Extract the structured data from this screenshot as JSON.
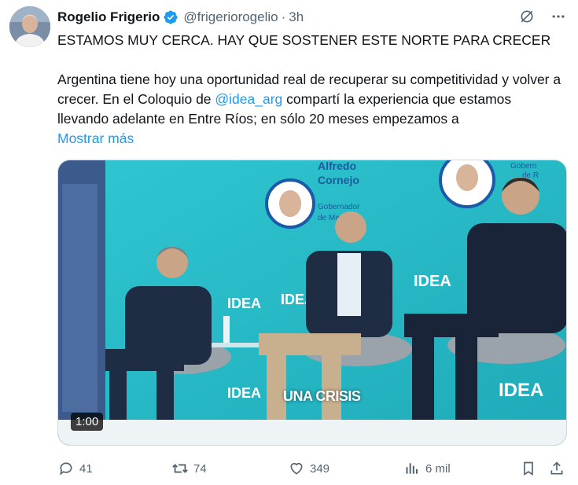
{
  "author": {
    "display_name": "Rogelio Frigerio",
    "handle": "@frigeriorogelio",
    "separator": "·",
    "time": "3h"
  },
  "icons": {
    "verified": "verified-badge-icon",
    "grok": "grok-icon",
    "more": "more-options-icon",
    "reply": "reply-icon",
    "retweet": "retweet-icon",
    "like": "heart-icon",
    "views": "views-icon",
    "bookmark": "bookmark-icon",
    "share": "share-icon"
  },
  "tweet": {
    "line1": "ESTAMOS MUY CERCA. HAY QUE SOSTENER ESTE NORTE PARA CRECER",
    "para_before_mention": "Argentina tiene hoy una oportunidad real de recuperar su competitividad y volver a crecer. En el Coloquio de ",
    "mention": "@idea_arg",
    "para_after_mention": " compartí la experiencia que estamos llevando adelante en Entre Ríos; en sólo 20 meses empezamos a",
    "show_more": "Mostrar más"
  },
  "media": {
    "duration": "1:00",
    "caption": "UNA CRISIS",
    "screen_name_1": "Alfredo",
    "screen_name_2": "Cornejo",
    "screen_role_1": "Gobernador",
    "screen_role_2": "de Men",
    "screen_role_3": "Gobern",
    "screen_role_4": "de R",
    "brand": "IDEA"
  },
  "stats": {
    "replies": "41",
    "retweets": "74",
    "likes": "349",
    "views": "6 mil"
  },
  "colors": {
    "accent": "#1d9bf0",
    "muted": "#536471",
    "text": "#0f1419",
    "stage_bg": "#34c2cf"
  }
}
